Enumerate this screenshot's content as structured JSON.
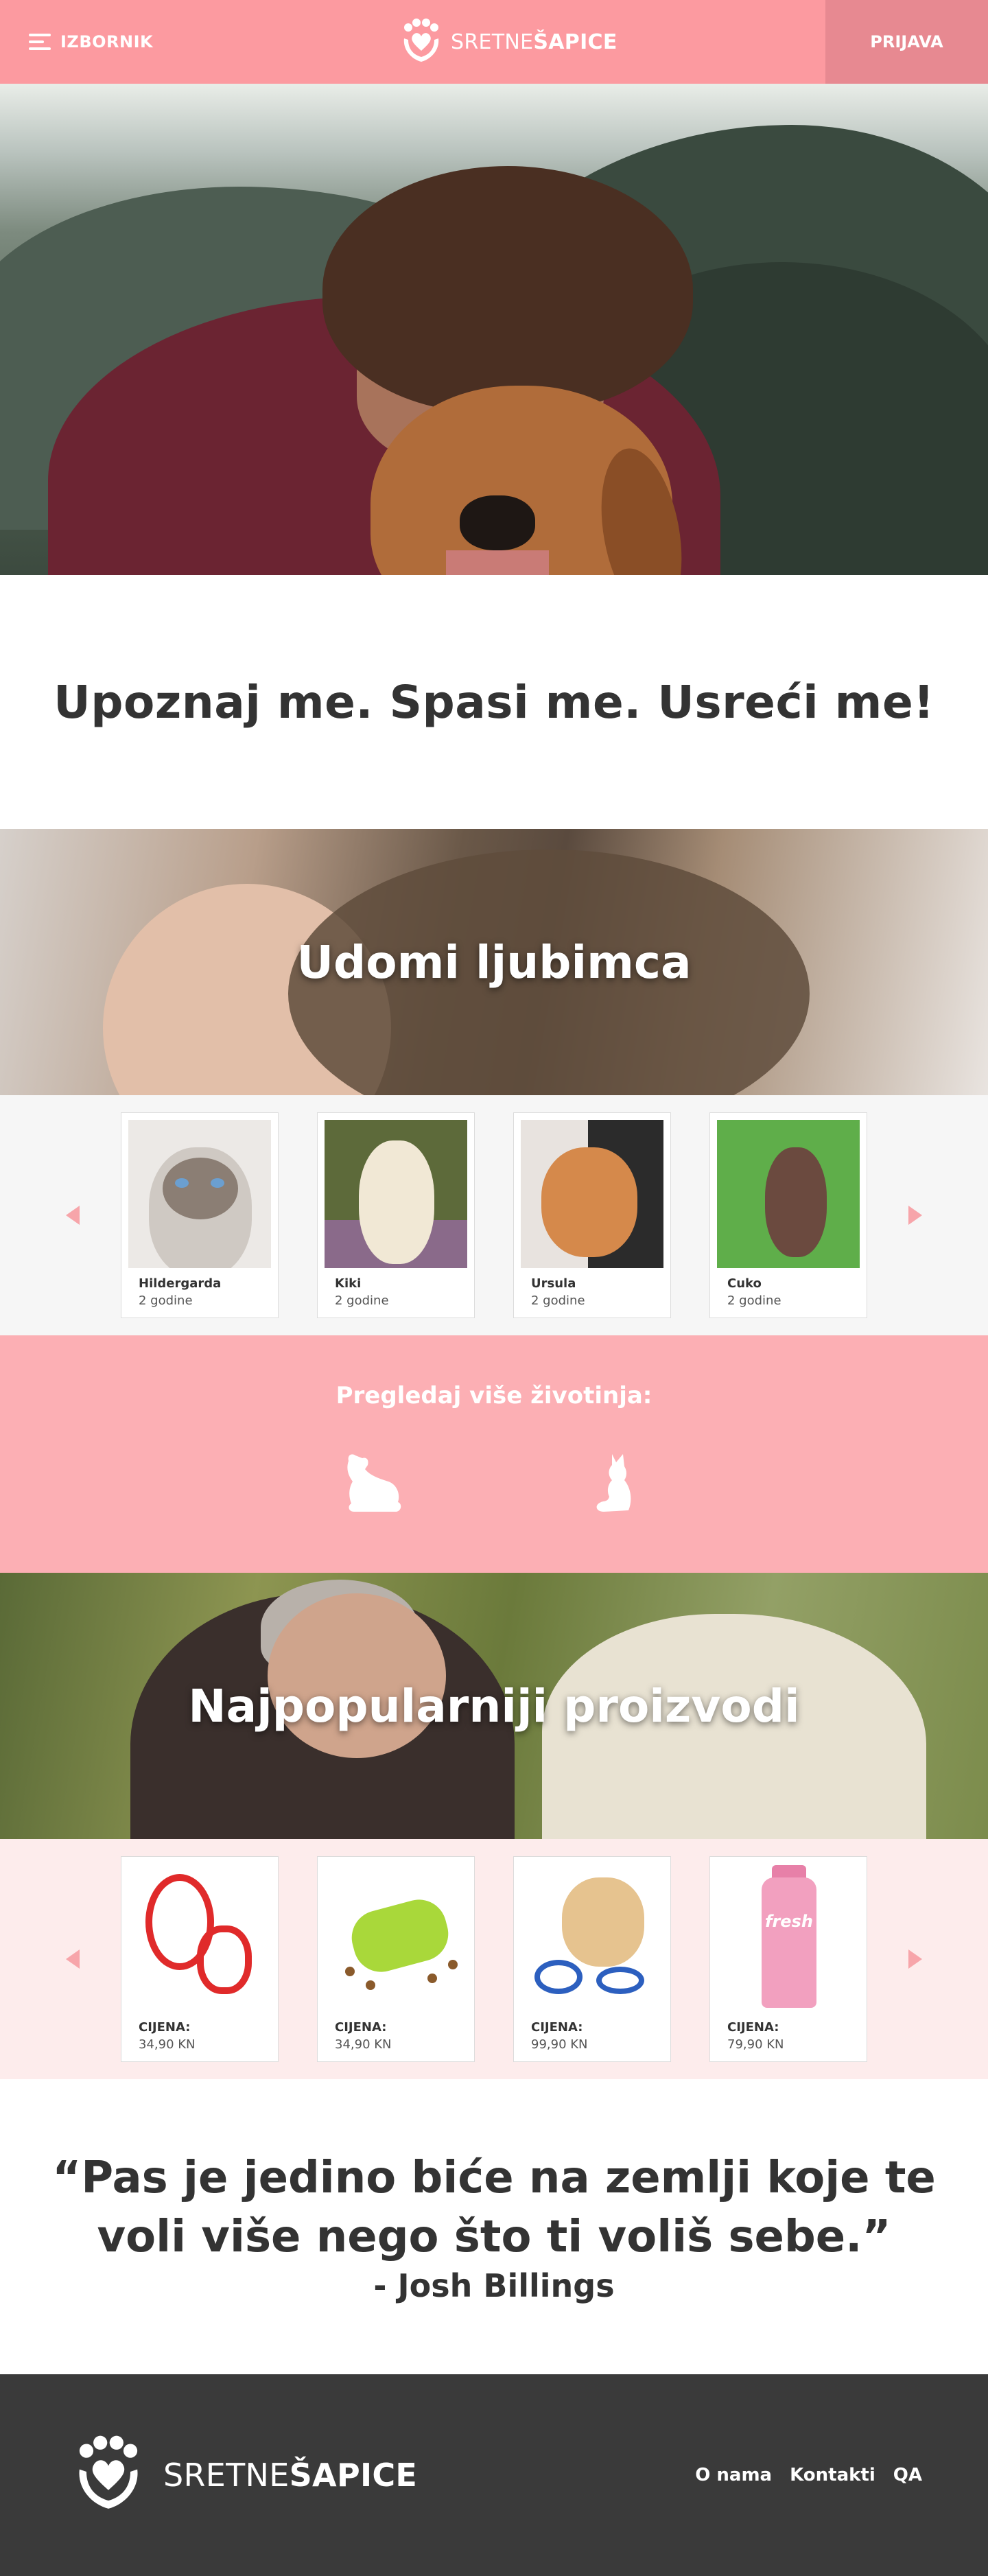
{
  "header": {
    "menu_label": "IZBORNIK",
    "logo_light": "SRETNE",
    "logo_bold": "ŠAPICE",
    "login_label": "PRIJAVA"
  },
  "tagline": "Upoznaj me. Spasi me. Usreći me!",
  "adopt": {
    "banner_title": "Udomi ljubimca",
    "pets": [
      {
        "name": "Hildergarda",
        "age": "2 godine"
      },
      {
        "name": "Kiki",
        "age": "2 godine"
      },
      {
        "name": "Ursula",
        "age": "2 godine"
      },
      {
        "name": "Cuko",
        "age": "2 godine"
      }
    ]
  },
  "browse": {
    "title": "Pregledaj više životinja:",
    "links": [
      "dog-icon",
      "cat-icon"
    ]
  },
  "products": {
    "banner_title": "Najpopularniji proizvodi",
    "price_label": "CIJENA:",
    "items": [
      {
        "price": "34,90 KN"
      },
      {
        "price": "34,90 KN"
      },
      {
        "price": "99,90 KN"
      },
      {
        "price": "79,90 KN",
        "label_text": "fresh"
      }
    ]
  },
  "quote": {
    "text": "“Pas je jedino biće na zemlji koje te voli više nego što ti voliš sebe.”",
    "author": "- Josh Billings"
  },
  "footer": {
    "logo_light": "SRETNE",
    "logo_bold": "ŠAPICE",
    "nav": [
      "O nama",
      "Kontakti",
      "QA"
    ]
  },
  "colors": {
    "brand_pink": "#fc9aa0",
    "login_pink": "#e78991",
    "browse_pink": "#fcafb4",
    "footer_dark": "#3a3a3a"
  }
}
